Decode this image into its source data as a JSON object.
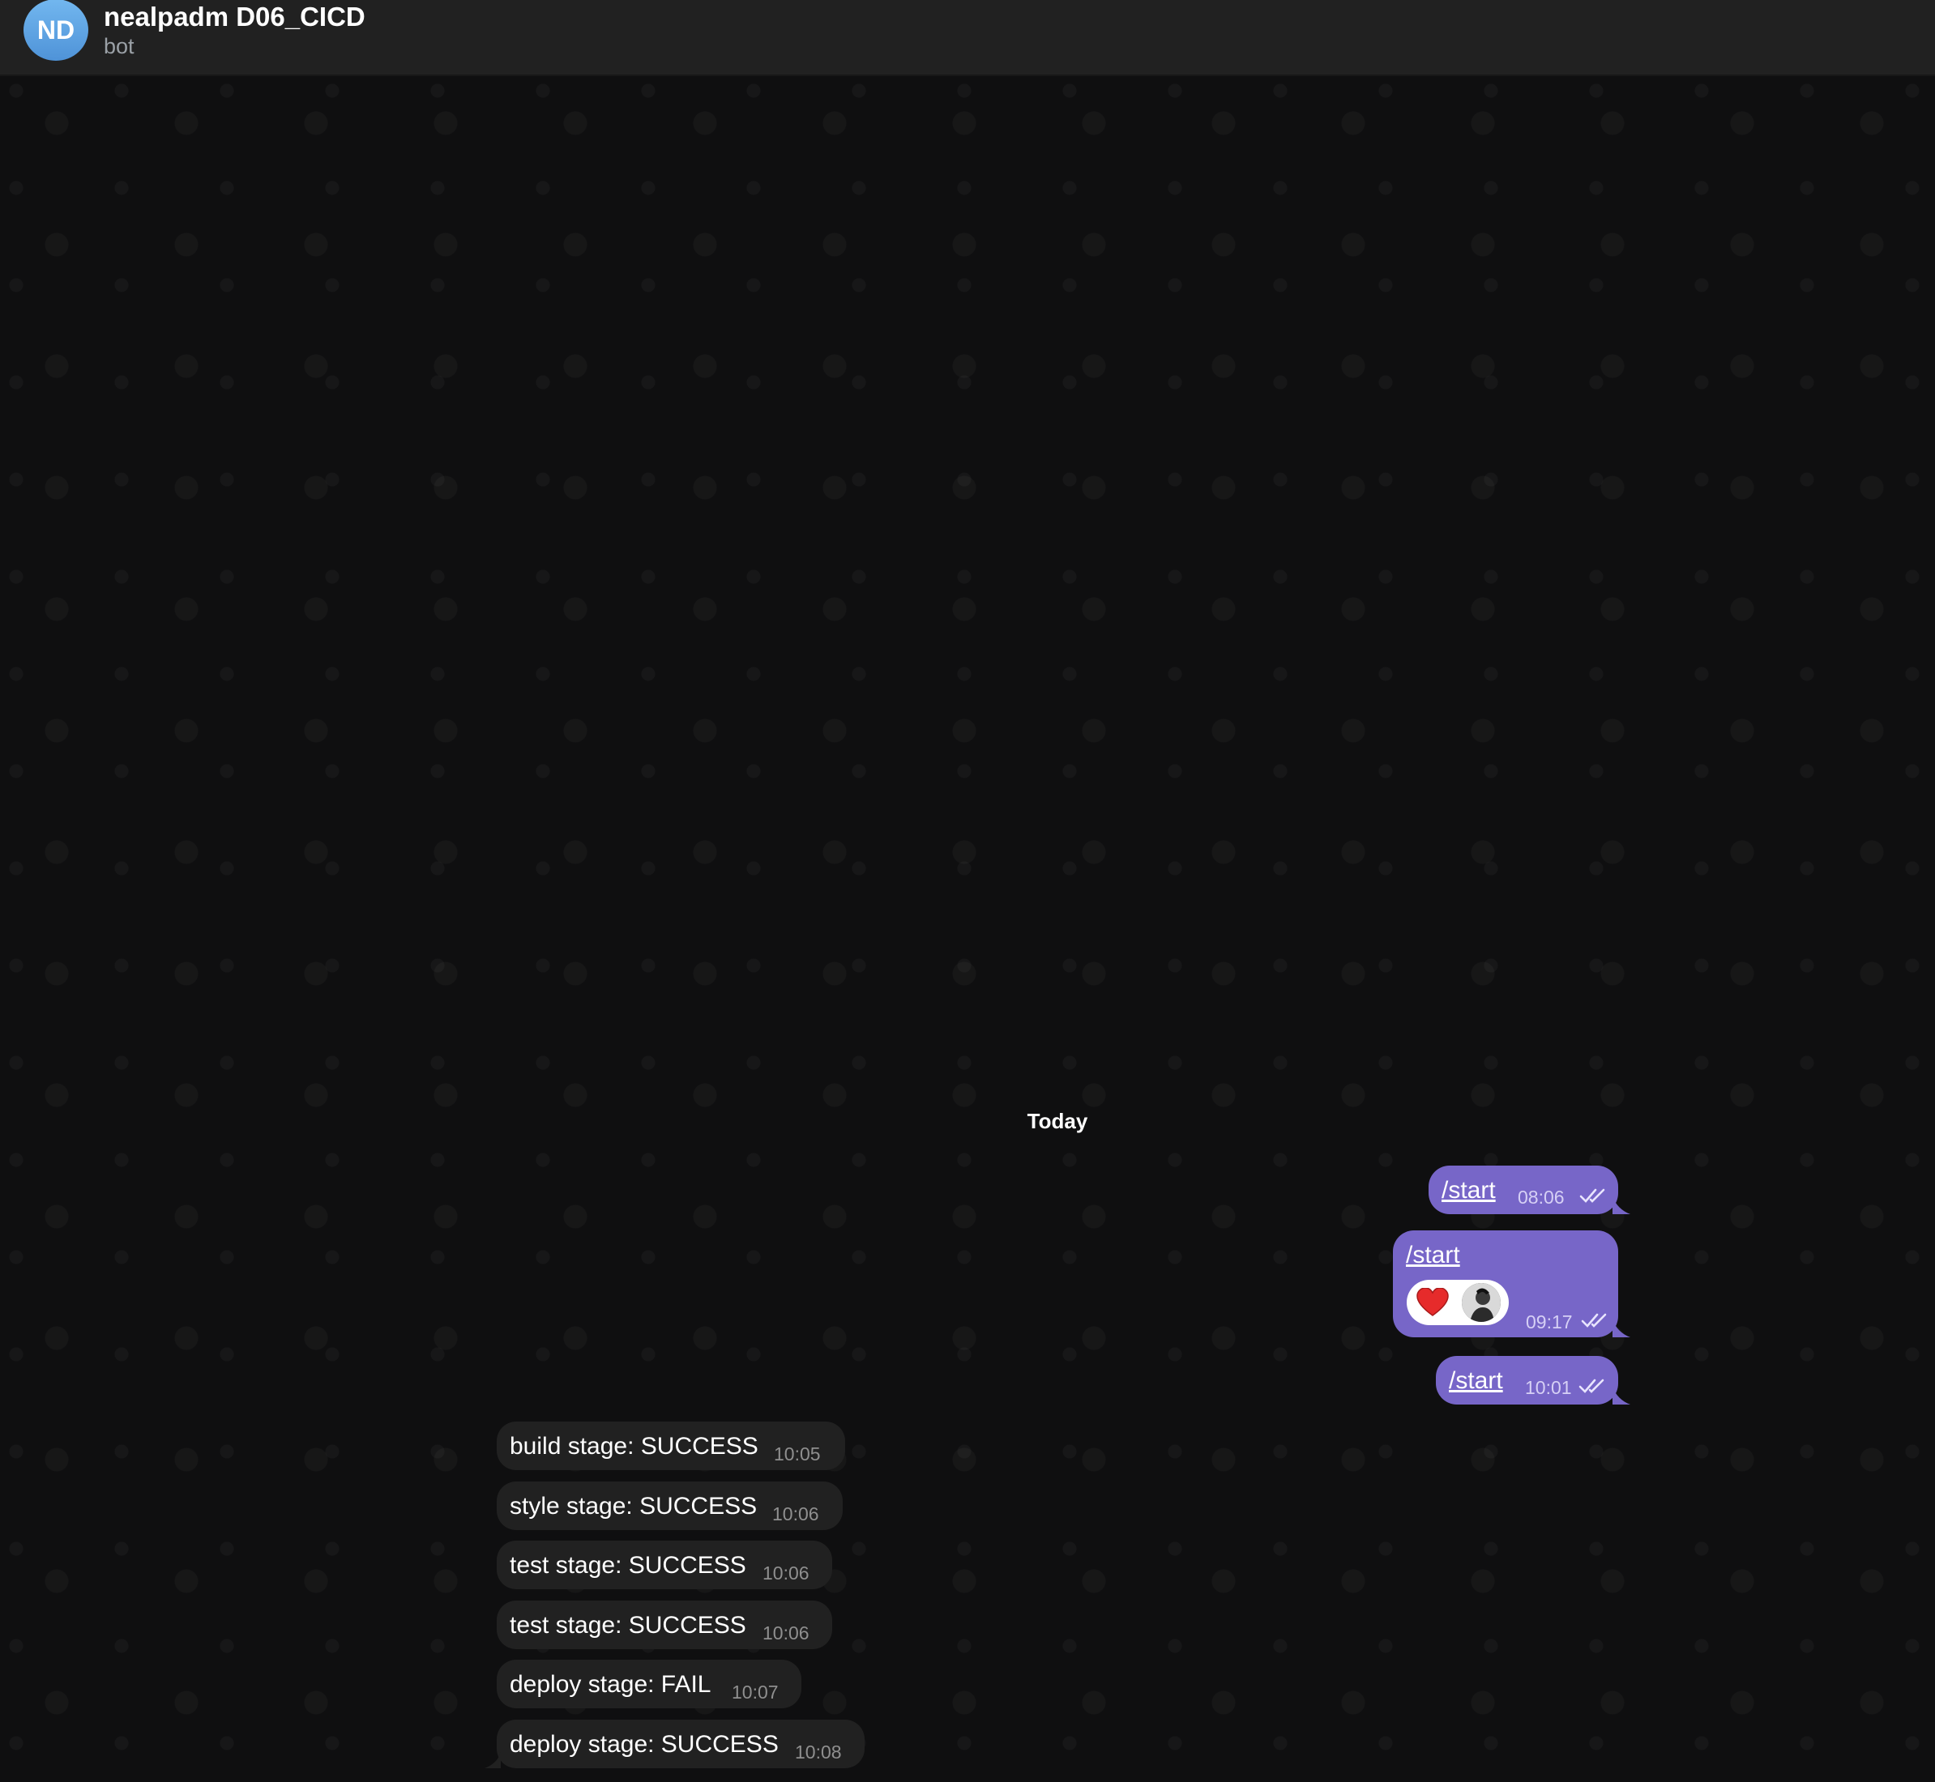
{
  "header": {
    "avatar_initials": "ND",
    "title": "nealpadm D06_CICD",
    "status": "bot"
  },
  "date_divider": "Today",
  "outgoing": [
    {
      "text": "/start",
      "time": "08:06"
    },
    {
      "text": "/start",
      "time": "09:17",
      "reactions": [
        "heart-emoji",
        "user-avatar"
      ]
    },
    {
      "text": "/start",
      "time": "10:01"
    }
  ],
  "incoming": [
    {
      "text": "build stage: SUCCESS",
      "time": "10:05"
    },
    {
      "text": "style stage: SUCCESS",
      "time": "10:06"
    },
    {
      "text": "test stage: SUCCESS",
      "time": "10:06"
    },
    {
      "text": "test stage: SUCCESS",
      "time": "10:06"
    },
    {
      "text": "deploy stage: FAIL",
      "time": "10:07"
    },
    {
      "text": "deploy stage: SUCCESS",
      "time": "10:08"
    }
  ],
  "colors": {
    "outgoing_bubble": "#7766c8",
    "incoming_bubble": "#212121",
    "header_bg": "#212121",
    "chat_bg": "#0f0f10",
    "avatar_blue": "#5fa6e6"
  }
}
